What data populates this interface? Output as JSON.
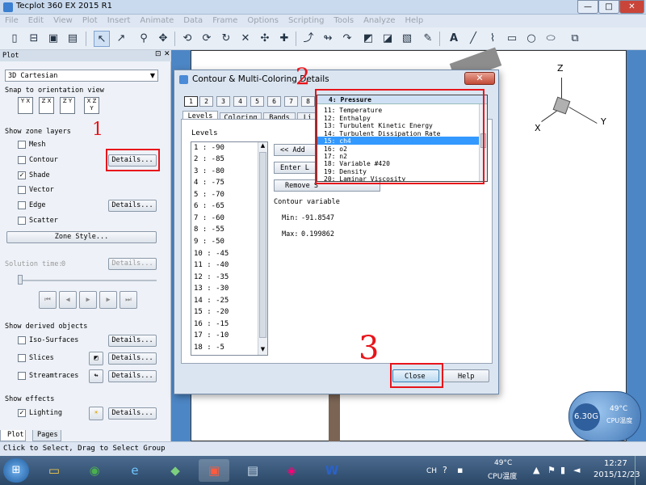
{
  "app": {
    "title": "Tecplot 360 EX 2015 R1"
  },
  "menu": [
    "File",
    "Edit",
    "View",
    "Plot",
    "Insert",
    "Animate",
    "Data",
    "Frame",
    "Options",
    "Scripting",
    "Tools",
    "Analyze",
    "Help"
  ],
  "toolbar_icons": [
    "new-icon",
    "open-icon",
    "save-icon",
    "print-icon",
    "select-icon",
    "adjust-icon",
    "zoom-icon",
    "translate-icon",
    "rotate-icon",
    "rollerball-icon",
    "spin-icon",
    "twist-icon",
    "translate-xy-icon",
    "probe-icon",
    "probe-at-icon",
    "probe-line-icon",
    "extract-icon",
    "contour-add-icon",
    "slice-icon",
    "pencil-icon",
    "text-icon",
    "line-icon",
    "rectangle-icon",
    "circle-icon",
    "ellipse-icon",
    "frame-icon"
  ],
  "panel": {
    "header": "Plot",
    "plot_type": "3D Cartesian",
    "snap_label": "Snap to orientation view",
    "orient_buttons": [
      "Y X",
      "Z X",
      "Z Y",
      "X Z Y"
    ],
    "zone_layers_label": "Show zone layers",
    "layers": [
      {
        "label": "Mesh",
        "checked": false
      },
      {
        "label": "Contour",
        "checked": false,
        "details": "Details..."
      },
      {
        "label": "Shade",
        "checked": true
      },
      {
        "label": "Vector",
        "checked": false
      },
      {
        "label": "Edge",
        "checked": false,
        "details": "Details..."
      },
      {
        "label": "Scatter",
        "checked": false
      }
    ],
    "zone_style": "Zone Style...",
    "solution_time_label": "Solution time:",
    "solution_time_value": "0",
    "solution_details": "Details...",
    "derived_label": "Show derived objects",
    "derived": [
      {
        "label": "Iso-Surfaces",
        "checked": false,
        "details": "Details..."
      },
      {
        "label": "Slices",
        "checked": false,
        "details": "Details..."
      },
      {
        "label": "Streamtraces",
        "checked": false,
        "details": "Details..."
      }
    ],
    "effects_label": "Show effects",
    "effects": [
      {
        "label": "Lighting",
        "checked": true,
        "details": "Details..."
      }
    ],
    "bottom_tabs": [
      "Plot",
      "Pages"
    ]
  },
  "axes": {
    "z": "Z",
    "x": "X",
    "y": "Y"
  },
  "status": "Click to Select, Drag to Select Group",
  "dialog": {
    "title": "Contour & Multi-Coloring Details",
    "close_x": "✕",
    "num_tabs": [
      "1",
      "2",
      "3",
      "4",
      "5",
      "6",
      "7",
      "8"
    ],
    "active_num_tab": "1",
    "sub_tabs": [
      "Levels",
      "Coloring",
      "Bands",
      "Li"
    ],
    "levels_label": "Levels",
    "levels": [
      "1 : -90",
      "2 : -85",
      "3 : -80",
      "4 : -75",
      "5 : -70",
      "6 : -65",
      "7 : -60",
      "8 : -55",
      "9 : -50",
      "10 : -45",
      "11 : -40",
      "12 : -35",
      "13 : -30",
      "14 : -25",
      "15 : -20",
      "16 : -15",
      "17 : -10",
      "18 : -5"
    ],
    "add_button": "<< Add",
    "enter_button": "Enter L",
    "remove_button": "Remove S",
    "contour_variable_label": "Contour variable",
    "min_label": "Min:",
    "min_value": "-91.8547",
    "max_label": "Max:",
    "max_value": "0.199862",
    "close_button": "Close",
    "help_button": "Help"
  },
  "variable_dropdown": {
    "selected_header": "4: Pressure",
    "items": [
      "11: Temperature",
      "12: Enthalpy",
      "13: Turbulent Kinetic Energy",
      "14: Turbulent Dissipation Rate",
      "15: ch4",
      "16: o2",
      "17: n2",
      "18: Variable #420",
      "19: Density",
      "20: Laminar Viscosity"
    ],
    "highlighted": "15: ch4"
  },
  "annotations": {
    "one": "1",
    "two": "2",
    "three": "3"
  },
  "cpu_widget": {
    "temp": "49°C",
    "label": "CPU温度",
    "speed": "6.30G"
  },
  "taskbar": {
    "lang": "CH",
    "tray_temp": "49°C",
    "tray_label": "CPU温度",
    "time": "12:27",
    "date": "2015/12/23"
  },
  "colors": {
    "highlight": "#3399ff",
    "annotation": "#e8141b"
  }
}
